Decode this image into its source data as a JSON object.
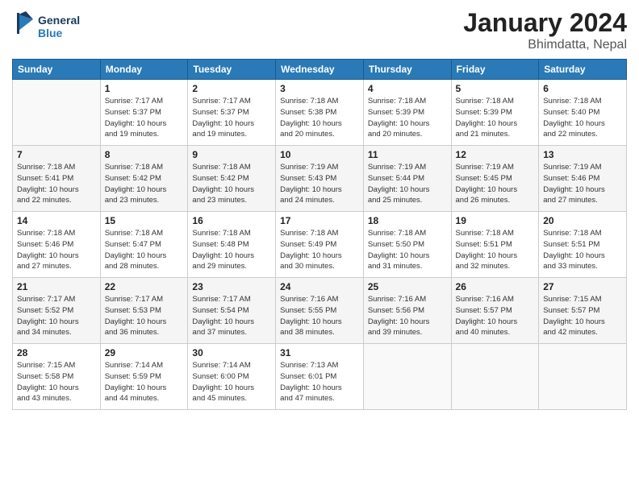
{
  "header": {
    "logo_general": "General",
    "logo_blue": "Blue",
    "month_title": "January 2024",
    "location": "Bhimdatta, Nepal"
  },
  "days_of_week": [
    "Sunday",
    "Monday",
    "Tuesday",
    "Wednesday",
    "Thursday",
    "Friday",
    "Saturday"
  ],
  "weeks": [
    [
      {
        "num": "",
        "sunrise": "",
        "sunset": "",
        "daylight": "",
        "empty": true
      },
      {
        "num": "1",
        "sunrise": "7:17 AM",
        "sunset": "5:37 PM",
        "daylight": "10 hours and 19 minutes."
      },
      {
        "num": "2",
        "sunrise": "7:17 AM",
        "sunset": "5:37 PM",
        "daylight": "10 hours and 19 minutes."
      },
      {
        "num": "3",
        "sunrise": "7:18 AM",
        "sunset": "5:38 PM",
        "daylight": "10 hours and 20 minutes."
      },
      {
        "num": "4",
        "sunrise": "7:18 AM",
        "sunset": "5:39 PM",
        "daylight": "10 hours and 20 minutes."
      },
      {
        "num": "5",
        "sunrise": "7:18 AM",
        "sunset": "5:39 PM",
        "daylight": "10 hours and 21 minutes."
      },
      {
        "num": "6",
        "sunrise": "7:18 AM",
        "sunset": "5:40 PM",
        "daylight": "10 hours and 22 minutes."
      }
    ],
    [
      {
        "num": "7",
        "sunrise": "7:18 AM",
        "sunset": "5:41 PM",
        "daylight": "10 hours and 22 minutes."
      },
      {
        "num": "8",
        "sunrise": "7:18 AM",
        "sunset": "5:42 PM",
        "daylight": "10 hours and 23 minutes."
      },
      {
        "num": "9",
        "sunrise": "7:18 AM",
        "sunset": "5:42 PM",
        "daylight": "10 hours and 23 minutes."
      },
      {
        "num": "10",
        "sunrise": "7:19 AM",
        "sunset": "5:43 PM",
        "daylight": "10 hours and 24 minutes."
      },
      {
        "num": "11",
        "sunrise": "7:19 AM",
        "sunset": "5:44 PM",
        "daylight": "10 hours and 25 minutes."
      },
      {
        "num": "12",
        "sunrise": "7:19 AM",
        "sunset": "5:45 PM",
        "daylight": "10 hours and 26 minutes."
      },
      {
        "num": "13",
        "sunrise": "7:19 AM",
        "sunset": "5:46 PM",
        "daylight": "10 hours and 27 minutes."
      }
    ],
    [
      {
        "num": "14",
        "sunrise": "7:18 AM",
        "sunset": "5:46 PM",
        "daylight": "10 hours and 27 minutes."
      },
      {
        "num": "15",
        "sunrise": "7:18 AM",
        "sunset": "5:47 PM",
        "daylight": "10 hours and 28 minutes."
      },
      {
        "num": "16",
        "sunrise": "7:18 AM",
        "sunset": "5:48 PM",
        "daylight": "10 hours and 29 minutes."
      },
      {
        "num": "17",
        "sunrise": "7:18 AM",
        "sunset": "5:49 PM",
        "daylight": "10 hours and 30 minutes."
      },
      {
        "num": "18",
        "sunrise": "7:18 AM",
        "sunset": "5:50 PM",
        "daylight": "10 hours and 31 minutes."
      },
      {
        "num": "19",
        "sunrise": "7:18 AM",
        "sunset": "5:51 PM",
        "daylight": "10 hours and 32 minutes."
      },
      {
        "num": "20",
        "sunrise": "7:18 AM",
        "sunset": "5:51 PM",
        "daylight": "10 hours and 33 minutes."
      }
    ],
    [
      {
        "num": "21",
        "sunrise": "7:17 AM",
        "sunset": "5:52 PM",
        "daylight": "10 hours and 34 minutes."
      },
      {
        "num": "22",
        "sunrise": "7:17 AM",
        "sunset": "5:53 PM",
        "daylight": "10 hours and 36 minutes."
      },
      {
        "num": "23",
        "sunrise": "7:17 AM",
        "sunset": "5:54 PM",
        "daylight": "10 hours and 37 minutes."
      },
      {
        "num": "24",
        "sunrise": "7:16 AM",
        "sunset": "5:55 PM",
        "daylight": "10 hours and 38 minutes."
      },
      {
        "num": "25",
        "sunrise": "7:16 AM",
        "sunset": "5:56 PM",
        "daylight": "10 hours and 39 minutes."
      },
      {
        "num": "26",
        "sunrise": "7:16 AM",
        "sunset": "5:57 PM",
        "daylight": "10 hours and 40 minutes."
      },
      {
        "num": "27",
        "sunrise": "7:15 AM",
        "sunset": "5:57 PM",
        "daylight": "10 hours and 42 minutes."
      }
    ],
    [
      {
        "num": "28",
        "sunrise": "7:15 AM",
        "sunset": "5:58 PM",
        "daylight": "10 hours and 43 minutes."
      },
      {
        "num": "29",
        "sunrise": "7:14 AM",
        "sunset": "5:59 PM",
        "daylight": "10 hours and 44 minutes."
      },
      {
        "num": "30",
        "sunrise": "7:14 AM",
        "sunset": "6:00 PM",
        "daylight": "10 hours and 45 minutes."
      },
      {
        "num": "31",
        "sunrise": "7:13 AM",
        "sunset": "6:01 PM",
        "daylight": "10 hours and 47 minutes."
      },
      {
        "num": "",
        "sunrise": "",
        "sunset": "",
        "daylight": "",
        "empty": true
      },
      {
        "num": "",
        "sunrise": "",
        "sunset": "",
        "daylight": "",
        "empty": true
      },
      {
        "num": "",
        "sunrise": "",
        "sunset": "",
        "daylight": "",
        "empty": true
      }
    ]
  ],
  "labels": {
    "sunrise": "Sunrise:",
    "sunset": "Sunset:",
    "daylight": "Daylight:"
  }
}
